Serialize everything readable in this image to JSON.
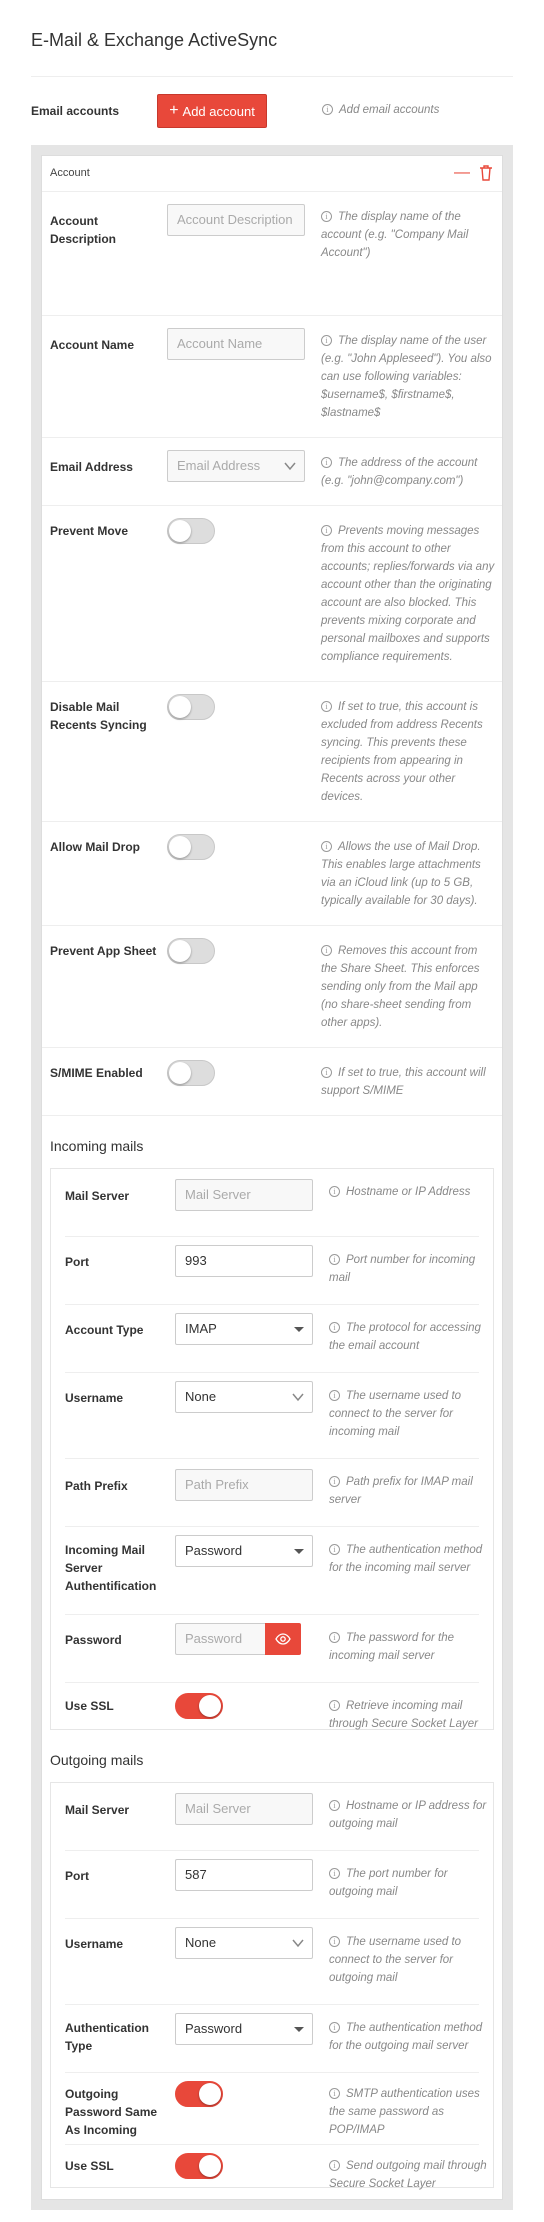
{
  "page": {
    "title": "E-Mail & Exchange ActiveSync"
  },
  "email_accounts": {
    "label": "Email accounts",
    "add_button": "Add account",
    "hint": "Add email accounts"
  },
  "account": {
    "panel_title": "Account",
    "description": {
      "label": "Account Description",
      "placeholder": "Account Description",
      "hint": "The display name of the account (e.g. \"Company Mail Account\")"
    },
    "name": {
      "label": "Account Name",
      "placeholder": "Account Name",
      "hint": "The display name of the user (e.g. \"John Appleseed\"). You also can use following variables: $username$, $firstname$, $lastname$"
    },
    "email": {
      "label": "Email Address",
      "placeholder": "Email Address",
      "hint": "The address of the account (e.g. \"john@company.com\")"
    },
    "prevent_move": {
      "label": "Prevent Move",
      "on": false,
      "hint": "Prevents moving messages from this account to other accounts; replies/forwards via any account other than the originating account are also blocked. This prevents mixing corporate and personal mailboxes and supports compliance requirements."
    },
    "disable_recents": {
      "label": "Disable Mail Recents Syncing",
      "on": false,
      "hint": "If set to true, this account is excluded from address Recents syncing. This prevents these recipients from appearing in Recents across your other devices."
    },
    "mail_drop": {
      "label": "Allow Mail Drop",
      "on": false,
      "hint": "Allows the use of Mail Drop. This enables large attachments via an iCloud link (up to 5 GB, typically available for 30 days)."
    },
    "app_sheet": {
      "label": "Prevent App Sheet",
      "on": false,
      "hint": "Removes this account from the Share Sheet. This enforces sending only from the Mail app (no share-sheet sending from other apps)."
    },
    "smime": {
      "label": "S/MIME Enabled",
      "on": false,
      "hint": "If set to true, this account will support S/MIME"
    }
  },
  "incoming": {
    "title": "Incoming mails",
    "server": {
      "label": "Mail Server",
      "placeholder": "Mail Server",
      "hint": "Hostname or IP Address"
    },
    "port": {
      "label": "Port",
      "value": "993",
      "hint": "Port number for incoming mail"
    },
    "type": {
      "label": "Account Type",
      "value": "IMAP",
      "hint": "The protocol for accessing the email account"
    },
    "username": {
      "label": "Username",
      "value": "None",
      "hint": "The username used to connect to the server for incoming mail"
    },
    "path_prefix": {
      "label": "Path Prefix",
      "placeholder": "Path Prefix",
      "hint": "Path prefix for IMAP mail server"
    },
    "auth": {
      "label": "Incoming Mail Server Authentification",
      "value": "Password",
      "hint": "The authentication method for the incoming mail server"
    },
    "password": {
      "label": "Password",
      "placeholder": "Password",
      "hint": "The password for the incoming mail server"
    },
    "ssl": {
      "label": "Use SSL",
      "on": true,
      "hint": "Retrieve incoming mail through Secure Socket Layer"
    }
  },
  "outgoing": {
    "title": "Outgoing mails",
    "server": {
      "label": "Mail Server",
      "placeholder": "Mail Server",
      "hint": "Hostname or IP address for outgoing mail"
    },
    "port": {
      "label": "Port",
      "value": "587",
      "hint": "The port number for outgoing mail"
    },
    "username": {
      "label": "Username",
      "value": "None",
      "hint": "The username used to connect to the server for outgoing mail"
    },
    "auth": {
      "label": "Authentication Type",
      "value": "Password",
      "hint": "The authentication method for the outgoing mail server"
    },
    "same_pw": {
      "label": "Outgoing Password Same As Incoming",
      "on": true,
      "hint": "SMTP authentication uses the same password as POP/IMAP"
    },
    "ssl": {
      "label": "Use SSL",
      "on": true,
      "hint": "Send outgoing mail through Secure Socket Layer"
    }
  },
  "colors": {
    "accent": "#e8483a",
    "toggle_off": "#dddddd"
  },
  "icons": [
    "plus-icon",
    "info-icon",
    "minus-icon",
    "trash-icon",
    "chevron-down-icon",
    "eye-icon"
  ]
}
